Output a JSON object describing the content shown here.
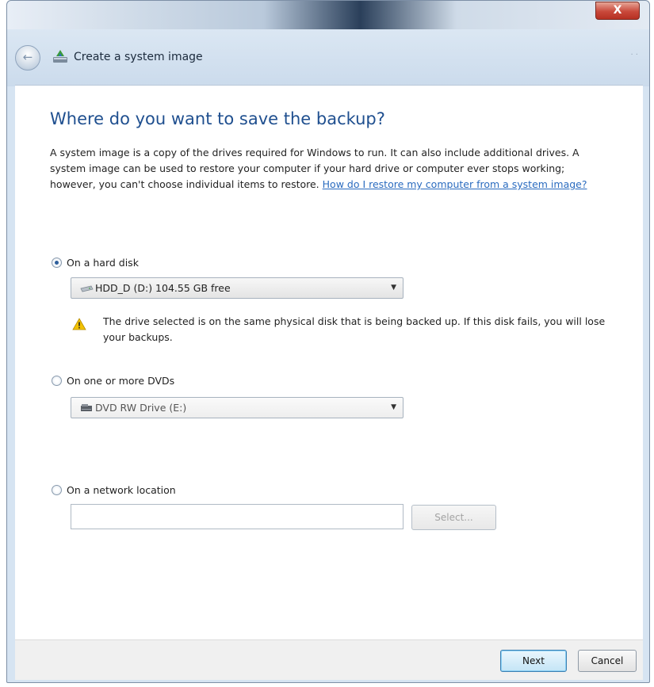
{
  "window": {
    "close_label": "X"
  },
  "nav": {
    "back_label": "←",
    "title": "Create a system image"
  },
  "page": {
    "heading": "Where do you want to save the backup?",
    "description": "A system image is a copy of the drives required for Windows to run. It can also include additional drives. A system image can be used to restore your computer if your hard drive or computer ever stops working; however, you can't choose individual items to restore.",
    "help_link": "How do I restore my computer from a system image?"
  },
  "options": {
    "hard_disk": {
      "label": "On a hard disk",
      "selected": true,
      "drive": "HDD_D (D:)  104.55 GB free",
      "warning": "The drive selected is on the same physical disk that is being backed up. If this disk fails, you will lose your backups."
    },
    "dvd": {
      "label": "On one or more DVDs",
      "selected": false,
      "drive": "DVD RW Drive (E:)"
    },
    "network": {
      "label": "On a network location",
      "selected": false,
      "path_value": "",
      "select_label": "Select..."
    }
  },
  "buttons": {
    "next": "Next",
    "cancel": "Cancel"
  },
  "icons": {
    "back": "back-arrow-icon",
    "wizard": "system-image-icon",
    "hard_drive": "hard-drive-icon",
    "dvd_drive": "dvd-drive-icon",
    "warning": "warning-triangle-icon",
    "dropdown": "chevron-down-icon"
  },
  "colors": {
    "heading": "#1f4f8f",
    "link": "#2a6bbf",
    "warning": "#f2c200",
    "close": "#c9493b"
  }
}
